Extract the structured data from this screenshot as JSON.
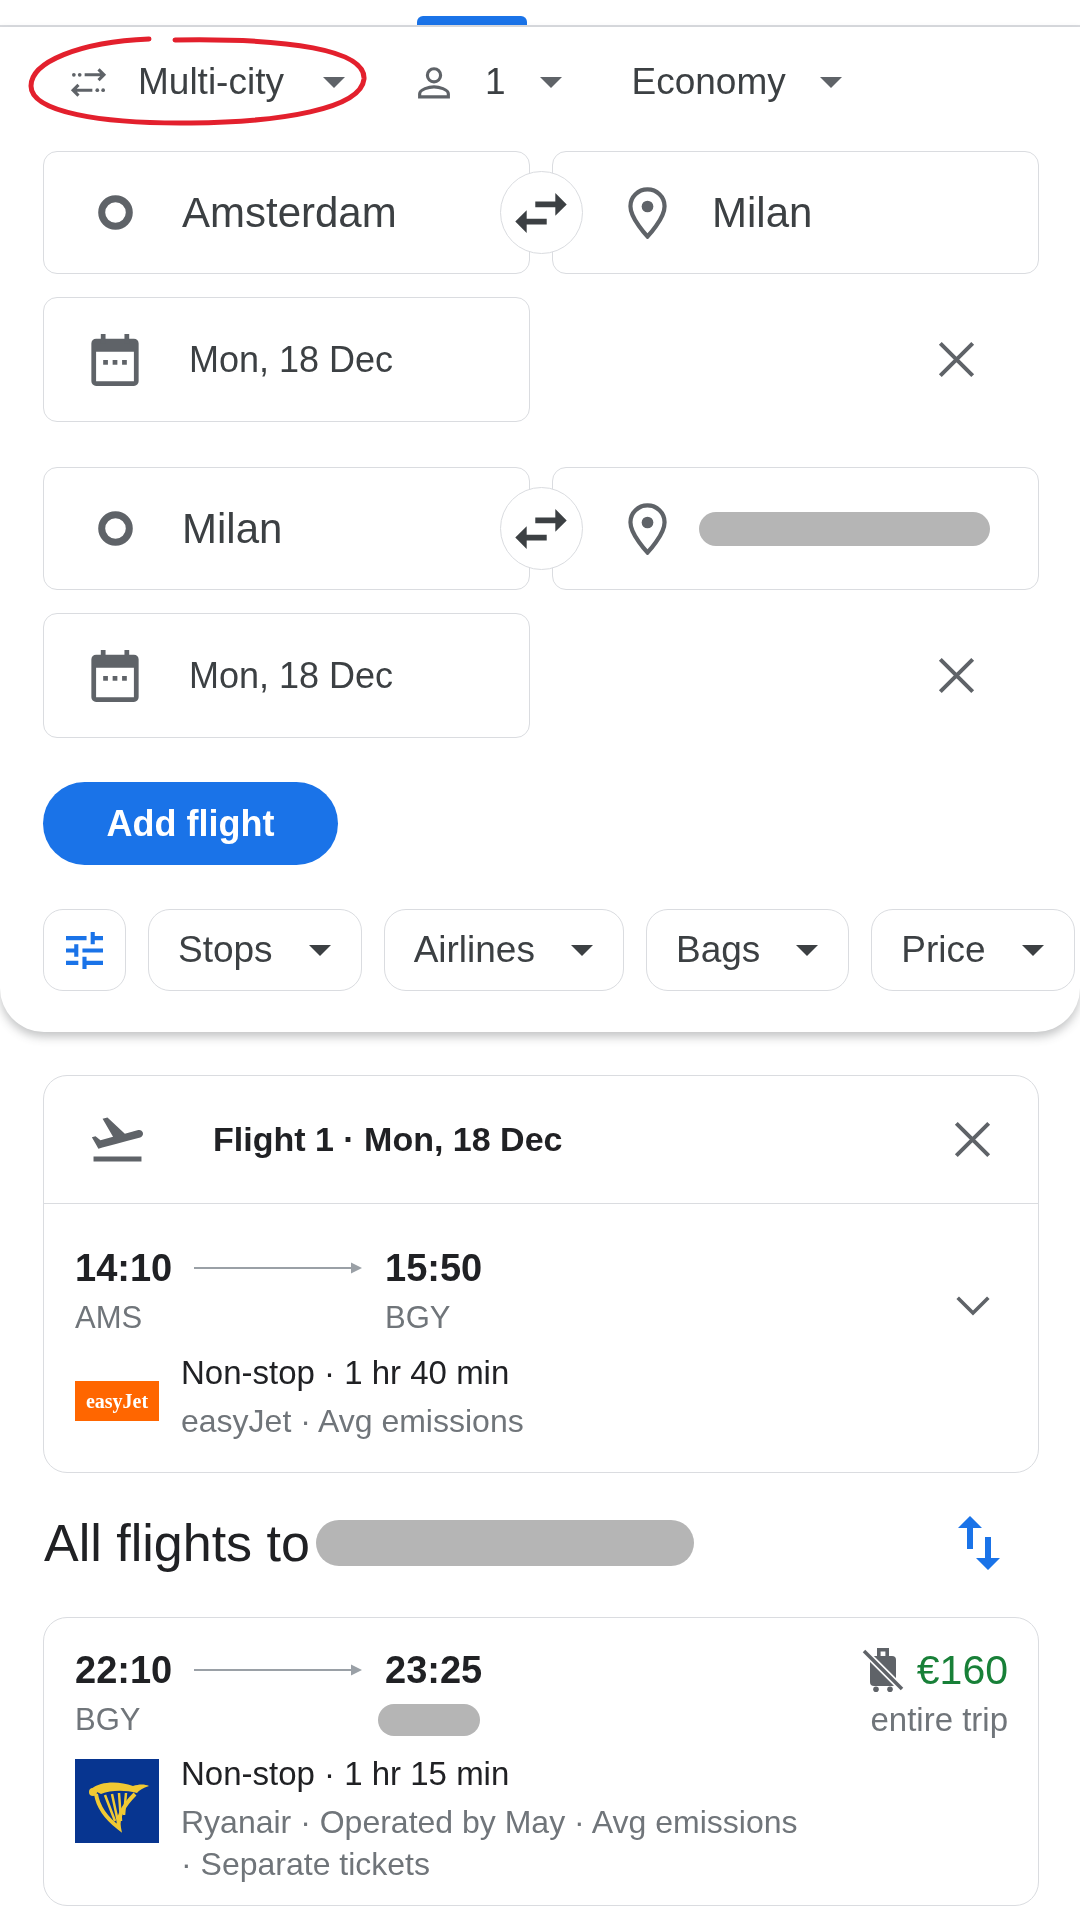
{
  "search": {
    "trip_type": {
      "label": "Multi-city",
      "highlighted": true
    },
    "passengers": {
      "label": "1"
    },
    "cabin_class": {
      "label": "Economy"
    },
    "legs": [
      {
        "origin": "Amsterdam",
        "destination": {
          "value": "Milan",
          "redacted": false
        },
        "date": "Mon, 18 Dec"
      },
      {
        "origin": "Milan",
        "destination": {
          "redacted": true
        },
        "date": "Mon, 18 Dec"
      }
    ],
    "add_flight_button": "Add flight",
    "filters": [
      "Stops",
      "Airlines",
      "Bags",
      "Price"
    ]
  },
  "selected_flight": {
    "title": "Flight 1 · Mon, 18 Dec",
    "departure": {
      "time": "14:10",
      "airport": "AMS"
    },
    "arrival": {
      "time": "15:50",
      "airport": "BGY"
    },
    "airline_logo": {
      "kind": "easyjet",
      "text": "easyJet"
    },
    "summary": "Non-stop · 1 hr 40 min",
    "details": "easyJet · Avg emissions"
  },
  "results": {
    "title": "All flights to",
    "destination_redacted": true,
    "flights": [
      {
        "departure": {
          "time": "22:10",
          "airport": "BGY"
        },
        "arrival": {
          "time": "23:25",
          "airport_redacted": true
        },
        "carry_on_allowed": false,
        "price": "€160",
        "price_note": "entire trip",
        "airline_logo": {
          "kind": "ryanair"
        },
        "summary": "Non-stop · 1 hr 15 min",
        "details": "Ryanair · Operated by May · Avg emissions · Separate tickets"
      }
    ]
  }
}
